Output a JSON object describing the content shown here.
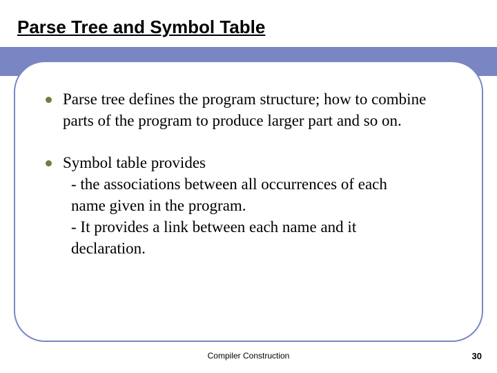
{
  "title": "Parse Tree and Symbol Table",
  "bullets": [
    {
      "text": "Parse tree defines the program structure; how to combine parts of the program to produce larger part and so on."
    },
    {
      "intro": "Symbol table provides",
      "sub1": "- the associations between all occurrences of  each",
      "sub1b": "  name given in the program.",
      "sub2": "- It provides a link between each name and it",
      "sub2b": "  declaration."
    }
  ],
  "footer": {
    "center": "Compiler Construction",
    "page": "30"
  }
}
